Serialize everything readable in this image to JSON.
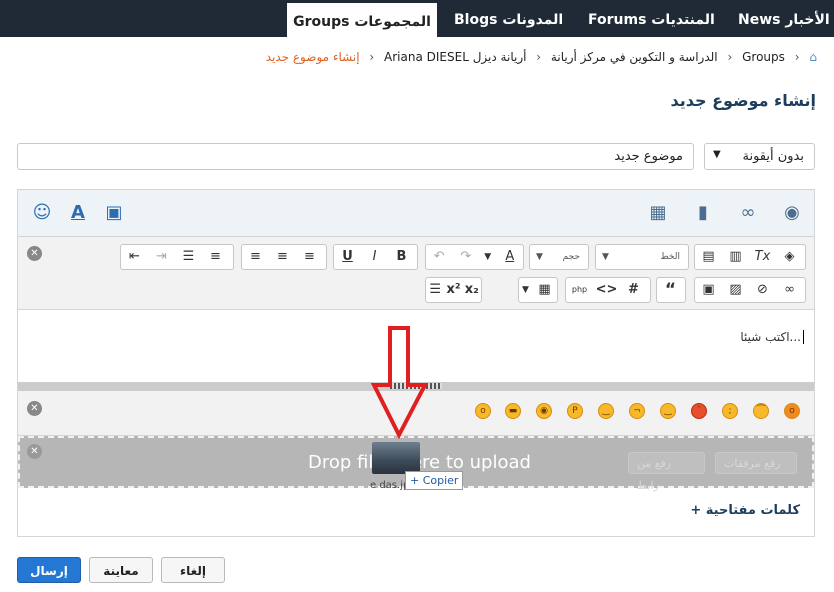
{
  "nav": {
    "tabs": [
      {
        "label": "Groups المجموعات",
        "active": true
      },
      {
        "label": "Blogs المدونات",
        "active": false
      },
      {
        "label": "Forums المنتديات",
        "active": false
      },
      {
        "label": "News الأخبار",
        "active": false
      }
    ]
  },
  "breadcrumb": {
    "items": [
      "Groups",
      "الدراسة و التكوين في مركز أريانة",
      "أريانة ديزل Ariana DIESEL",
      "إنشاء موضوع جديد"
    ]
  },
  "page": {
    "title": "إنشاء موضوع جديد",
    "topic_title_value": "موضوع جديد",
    "icon_select": "بدون أيقونة",
    "editor_placeholder": "اكتب شيئا...",
    "keywords_label": "كلمات مفتاحية +",
    "font_select": "الخط",
    "size_select": "حجم"
  },
  "dropzone": {
    "text": "Drop files here to upload",
    "upload_button": "رفع مرفقات",
    "link_button": "رفع من رابط",
    "dragged_file": "e das.jpg",
    "copy_hint": "+ Copier"
  },
  "buttons": {
    "submit": "إرسال",
    "preview": "معاينة",
    "cancel": "إلغاء"
  },
  "colors": {
    "nav_bg": "#1f2a36",
    "accent": "#2478d4",
    "breadcrumb_active": "#e06020",
    "drop_arrow": "#e02020"
  }
}
